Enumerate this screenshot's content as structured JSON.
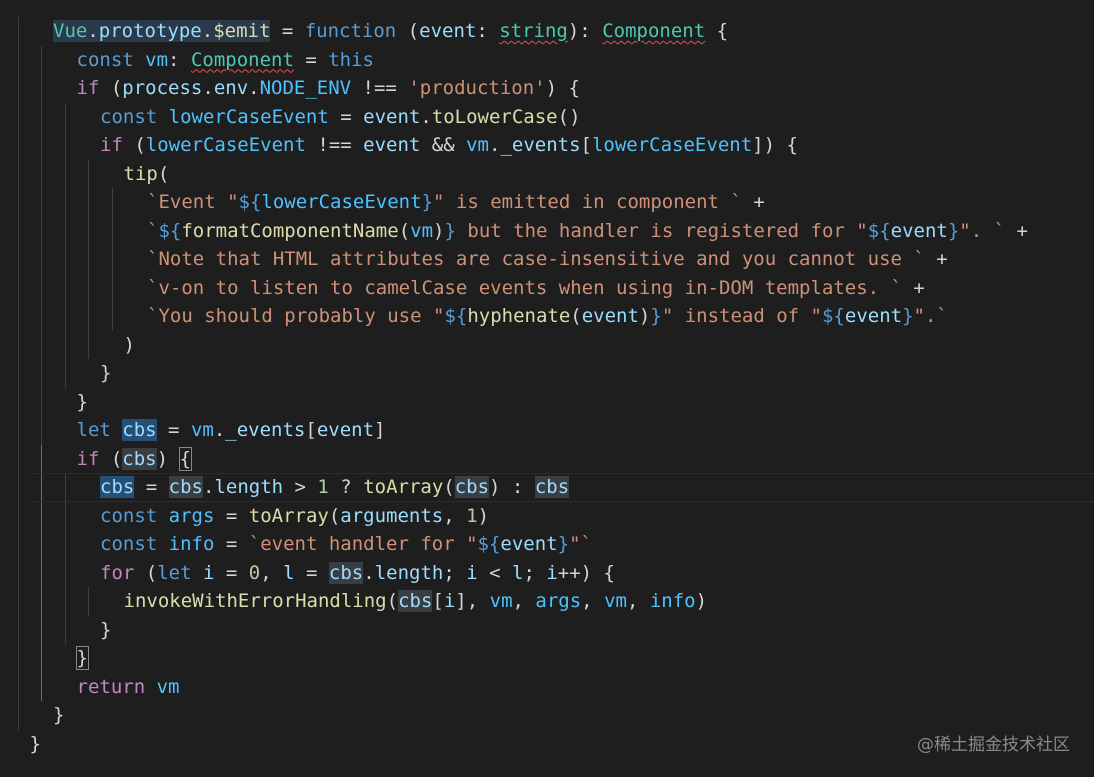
{
  "editor": {
    "lines": [
      [
        [
          "Vue",
          "type hlsel"
        ],
        [
          ".",
          "punc hlsel"
        ],
        [
          "prototype",
          "var hlsel"
        ],
        [
          ".",
          "punc hlsel"
        ],
        [
          "$emit",
          "fn hlsel"
        ],
        [
          " = ",
          "punc"
        ],
        [
          "function",
          "kw"
        ],
        [
          " (",
          "punc"
        ],
        [
          "event",
          "var"
        ],
        [
          ": ",
          "punc"
        ],
        [
          "string",
          "type squig"
        ],
        [
          "): ",
          "punc"
        ],
        [
          "Component",
          "type squig"
        ],
        [
          " {",
          "punc"
        ]
      ],
      [
        [
          "const",
          "kw"
        ],
        [
          " ",
          "punc"
        ],
        [
          "vm",
          "const"
        ],
        [
          ": ",
          "punc"
        ],
        [
          "Component",
          "type squig"
        ],
        [
          " = ",
          "punc"
        ],
        [
          "this",
          "kw"
        ]
      ],
      [
        [
          "if",
          "ctrl"
        ],
        [
          " (",
          "punc"
        ],
        [
          "process",
          "var"
        ],
        [
          ".",
          "punc"
        ],
        [
          "env",
          "var"
        ],
        [
          ".",
          "punc"
        ],
        [
          "NODE_ENV",
          "const"
        ],
        [
          " !== ",
          "punc"
        ],
        [
          "'production'",
          "str"
        ],
        [
          ") {",
          "punc"
        ]
      ],
      [
        [
          "const",
          "kw"
        ],
        [
          " ",
          "punc"
        ],
        [
          "lowerCaseEvent",
          "const"
        ],
        [
          " = ",
          "punc"
        ],
        [
          "event",
          "var"
        ],
        [
          ".",
          "punc"
        ],
        [
          "toLowerCase",
          "fn"
        ],
        [
          "()",
          "punc"
        ]
      ],
      [
        [
          "if",
          "ctrl"
        ],
        [
          " (",
          "punc"
        ],
        [
          "lowerCaseEvent",
          "const"
        ],
        [
          " !== ",
          "punc"
        ],
        [
          "event",
          "var"
        ],
        [
          " && ",
          "punc"
        ],
        [
          "vm",
          "const"
        ],
        [
          ".",
          "punc"
        ],
        [
          "_events",
          "var"
        ],
        [
          "[",
          "punc"
        ],
        [
          "lowerCaseEvent",
          "const"
        ],
        [
          "]) {",
          "punc"
        ]
      ],
      [
        [
          "tip",
          "fn"
        ],
        [
          "(",
          "punc"
        ]
      ],
      [
        [
          "`Event \"",
          "str"
        ],
        [
          "${",
          "tplp"
        ],
        [
          "lowerCaseEvent",
          "const"
        ],
        [
          "}",
          "tplp"
        ],
        [
          "\" is emitted in component `",
          "str"
        ],
        [
          " +",
          "punc"
        ]
      ],
      [
        [
          "`",
          "str"
        ],
        [
          "${",
          "tplp"
        ],
        [
          "formatComponentName",
          "fn"
        ],
        [
          "(",
          "punc"
        ],
        [
          "vm",
          "const"
        ],
        [
          ")",
          "punc"
        ],
        [
          "}",
          "tplp"
        ],
        [
          " but the handler is registered for \"",
          "str"
        ],
        [
          "${",
          "tplp"
        ],
        [
          "event",
          "var"
        ],
        [
          "}",
          "tplp"
        ],
        [
          "\". `",
          "str"
        ],
        [
          " +",
          "punc"
        ]
      ],
      [
        [
          "`Note that HTML attributes are case-insensitive and you cannot use `",
          "str"
        ],
        [
          " +",
          "punc"
        ]
      ],
      [
        [
          "`v-on to listen to camelCase events when using in-DOM templates. `",
          "str"
        ],
        [
          " +",
          "punc"
        ]
      ],
      [
        [
          "`You should probably use \"",
          "str"
        ],
        [
          "${",
          "tplp"
        ],
        [
          "hyphenate",
          "fn"
        ],
        [
          "(",
          "punc"
        ],
        [
          "event",
          "var"
        ],
        [
          ")",
          "punc"
        ],
        [
          "}",
          "tplp"
        ],
        [
          "\" instead of \"",
          "str"
        ],
        [
          "${",
          "tplp"
        ],
        [
          "event",
          "var"
        ],
        [
          "}",
          "tplp"
        ],
        [
          "\".`",
          "str"
        ]
      ],
      [
        [
          ")",
          "punc"
        ]
      ],
      [
        [
          "}",
          "punc"
        ]
      ],
      [
        [
          "}",
          "punc"
        ]
      ],
      [
        [
          "let",
          "kw"
        ],
        [
          " ",
          "punc"
        ],
        [
          "cbs",
          "var hl"
        ],
        [
          " = ",
          "punc"
        ],
        [
          "vm",
          "const"
        ],
        [
          ".",
          "punc"
        ],
        [
          "_events",
          "var"
        ],
        [
          "[",
          "punc"
        ],
        [
          "event",
          "var"
        ],
        [
          "]",
          "punc"
        ]
      ],
      [
        [
          "if",
          "ctrl"
        ],
        [
          " (",
          "punc"
        ],
        [
          "cbs",
          "var hl2"
        ],
        [
          ") ",
          "punc"
        ],
        [
          "{",
          "punc bracket"
        ]
      ],
      [
        [
          "cbs",
          "var hl"
        ],
        [
          " = ",
          "punc"
        ],
        [
          "cbs",
          "var hl2"
        ],
        [
          ".",
          "punc"
        ],
        [
          "length",
          "var"
        ],
        [
          " > ",
          "punc"
        ],
        [
          "1",
          "num"
        ],
        [
          " ? ",
          "punc"
        ],
        [
          "toArray",
          "fn"
        ],
        [
          "(",
          "punc"
        ],
        [
          "cbs",
          "var hl2"
        ],
        [
          ") : ",
          "punc"
        ],
        [
          "cbs",
          "var hl2"
        ]
      ],
      [
        [
          "const",
          "kw"
        ],
        [
          " ",
          "punc"
        ],
        [
          "args",
          "const"
        ],
        [
          " = ",
          "punc"
        ],
        [
          "toArray",
          "fn"
        ],
        [
          "(",
          "punc"
        ],
        [
          "arguments",
          "var"
        ],
        [
          ", ",
          "punc"
        ],
        [
          "1",
          "num"
        ],
        [
          ")",
          "punc"
        ]
      ],
      [
        [
          "const",
          "kw"
        ],
        [
          " ",
          "punc"
        ],
        [
          "info",
          "const"
        ],
        [
          " = ",
          "punc"
        ],
        [
          "`event handler for \"",
          "str"
        ],
        [
          "${",
          "tplp"
        ],
        [
          "event",
          "var"
        ],
        [
          "}",
          "tplp"
        ],
        [
          "\"`",
          "str"
        ]
      ],
      [
        [
          "for",
          "ctrl"
        ],
        [
          " (",
          "punc"
        ],
        [
          "let",
          "kw"
        ],
        [
          " ",
          "punc"
        ],
        [
          "i",
          "var"
        ],
        [
          " = ",
          "punc"
        ],
        [
          "0",
          "num"
        ],
        [
          ", ",
          "punc"
        ],
        [
          "l",
          "var"
        ],
        [
          " = ",
          "punc"
        ],
        [
          "cbs",
          "var hl2"
        ],
        [
          ".",
          "punc"
        ],
        [
          "length",
          "var"
        ],
        [
          "; ",
          "punc"
        ],
        [
          "i",
          "var"
        ],
        [
          " < ",
          "punc"
        ],
        [
          "l",
          "var"
        ],
        [
          "; ",
          "punc"
        ],
        [
          "i",
          "var"
        ],
        [
          "++) {",
          "punc"
        ]
      ],
      [
        [
          "invokeWithErrorHandling",
          "fn"
        ],
        [
          "(",
          "punc"
        ],
        [
          "cbs",
          "var hl2"
        ],
        [
          "[",
          "punc"
        ],
        [
          "i",
          "var"
        ],
        [
          "], ",
          "punc"
        ],
        [
          "vm",
          "const"
        ],
        [
          ", ",
          "punc"
        ],
        [
          "args",
          "const"
        ],
        [
          ", ",
          "punc"
        ],
        [
          "vm",
          "const"
        ],
        [
          ", ",
          "punc"
        ],
        [
          "info",
          "const"
        ],
        [
          ")",
          "punc"
        ]
      ],
      [
        [
          "}",
          "punc"
        ]
      ],
      [
        [
          "}",
          "punc bracket"
        ]
      ],
      [
        [
          "return",
          "ctrl"
        ],
        [
          " ",
          "punc"
        ],
        [
          "vm",
          "const"
        ]
      ],
      [
        [
          "}",
          "punc"
        ]
      ],
      [
        [
          "}",
          "punc"
        ]
      ]
    ]
  },
  "watermark": "@稀土掘金技术社区"
}
